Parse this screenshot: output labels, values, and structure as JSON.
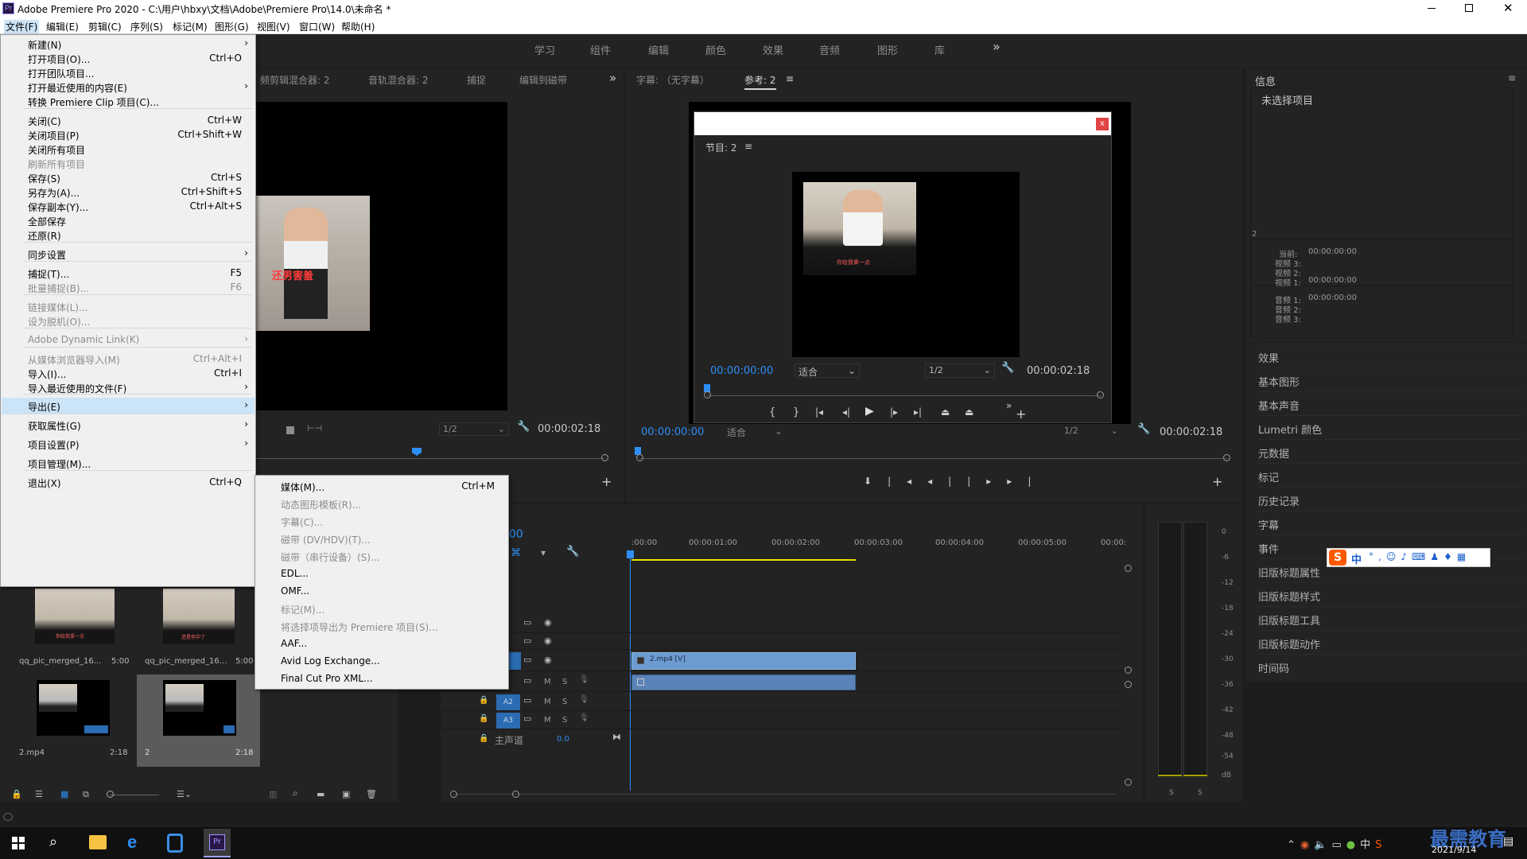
{
  "window": {
    "title": "Adobe Premiere Pro 2020 - C:\\用户\\hbxy\\文档\\Adobe\\Premiere Pro\\14.0\\未命名 *",
    "app_icon": "Pr",
    "controls": [
      "minimize-icon",
      "maximize-icon",
      "close-icon"
    ]
  },
  "menubar": [
    "文件(F)",
    "编辑(E)",
    "剪辑(C)",
    "序列(S)",
    "标记(M)",
    "图形(G)",
    "视图(V)",
    "窗口(W)",
    "帮助(H)"
  ],
  "workspaces": [
    "学习",
    "组件",
    "编辑",
    "颜色",
    "效果",
    "音频",
    "图形",
    "库"
  ],
  "workspace_more": "»",
  "source_panel": {
    "tabs": [
      "频剪辑混合器: 2",
      "音轨混合器: 2",
      "捕捉",
      "编辑到磁带"
    ],
    "more": "»",
    "res": "1/2",
    "timecode": "00:00:02:18",
    "caption": "还男害羞"
  },
  "program_panel": {
    "tabs": [
      "字幕: （无字幕）",
      "参考: 2"
    ],
    "dialog_close": "x",
    "dialog_label": "节目: 2",
    "video_caption": "你给我拿一点",
    "tc_left": "00:00:00:00",
    "fit": "适合",
    "res": "1/2",
    "tc_right": "00:00:02:18",
    "bottom_tc_left": "00:00:00:00",
    "bottom_fit": "适合",
    "bottom_res": "1/2",
    "bottom_tc_right": "00:00:02:18"
  },
  "info_panel": {
    "title": "信息",
    "none_selected": "未选择项目",
    "seq_num": "2",
    "current_label": "当前:",
    "current_tc": "00:00:00:00",
    "video3": "视频 3:",
    "video2": "视频 2:",
    "video1": "视频 1:",
    "video1_tc": "00:00:00:00",
    "audio1": "音频 1:",
    "audio1_tc": "00:00:00:00",
    "audio2": "音频 2:",
    "audio3": "音频 3:"
  },
  "right_panels": [
    "效果",
    "基本图形",
    "基本声音",
    "Lumetri 颜色",
    "元数据",
    "标记",
    "历史记录",
    "字幕",
    "事件",
    "旧版标题属性",
    "旧版标题样式",
    "旧版标题工具",
    "旧版标题动作",
    "时间码"
  ],
  "file_menu": {
    "items": [
      {
        "label": "新建(N)",
        "shortcut": "",
        "arrow": true,
        "disabled": false
      },
      {
        "label": "打开项目(O)...",
        "shortcut": "Ctrl+O",
        "arrow": false,
        "disabled": false
      },
      {
        "label": "打开团队项目...",
        "shortcut": "",
        "arrow": false,
        "disabled": false
      },
      {
        "label": "打开最近使用的内容(E)",
        "shortcut": "",
        "arrow": true,
        "disabled": false
      },
      {
        "label": "转换 Premiere Clip 项目(C)...",
        "shortcut": "",
        "arrow": false,
        "disabled": false
      },
      {
        "label": "关闭(C)",
        "shortcut": "Ctrl+W",
        "arrow": false,
        "disabled": false
      },
      {
        "label": "关闭项目(P)",
        "shortcut": "Ctrl+Shift+W",
        "arrow": false,
        "disabled": false
      },
      {
        "label": "关闭所有项目",
        "shortcut": "",
        "arrow": false,
        "disabled": false
      },
      {
        "label": "刷新所有项目",
        "shortcut": "",
        "arrow": false,
        "disabled": true
      },
      {
        "label": "保存(S)",
        "shortcut": "Ctrl+S",
        "arrow": false,
        "disabled": false
      },
      {
        "label": "另存为(A)...",
        "shortcut": "Ctrl+Shift+S",
        "arrow": false,
        "disabled": false
      },
      {
        "label": "保存副本(Y)...",
        "shortcut": "Ctrl+Alt+S",
        "arrow": false,
        "disabled": false
      },
      {
        "label": "全部保存",
        "shortcut": "",
        "arrow": false,
        "disabled": false
      },
      {
        "label": "还原(R)",
        "shortcut": "",
        "arrow": false,
        "disabled": false
      },
      {
        "label": "同步设置",
        "shortcut": "",
        "arrow": true,
        "disabled": false
      },
      {
        "label": "捕捉(T)...",
        "shortcut": "F5",
        "arrow": false,
        "disabled": false
      },
      {
        "label": "批量捕捉(B)...",
        "shortcut": "F6",
        "arrow": false,
        "disabled": true
      },
      {
        "label": "链接媒体(L)...",
        "shortcut": "",
        "arrow": false,
        "disabled": true
      },
      {
        "label": "设为脱机(O)...",
        "shortcut": "",
        "arrow": false,
        "disabled": true
      },
      {
        "label": "Adobe Dynamic Link(K)",
        "shortcut": "",
        "arrow": true,
        "disabled": true
      },
      {
        "label": "从媒体浏览器导入(M)",
        "shortcut": "Ctrl+Alt+I",
        "arrow": false,
        "disabled": true
      },
      {
        "label": "导入(I)...",
        "shortcut": "Ctrl+I",
        "arrow": false,
        "disabled": false
      },
      {
        "label": "导入最近使用的文件(F)",
        "shortcut": "",
        "arrow": true,
        "disabled": false
      },
      {
        "label": "导出(E)",
        "shortcut": "",
        "arrow": true,
        "disabled": false
      },
      {
        "label": "获取属性(G)",
        "shortcut": "",
        "arrow": true,
        "disabled": false
      },
      {
        "label": "项目设置(P)",
        "shortcut": "",
        "arrow": true,
        "disabled": false
      },
      {
        "label": "项目管理(M)...",
        "shortcut": "",
        "arrow": false,
        "disabled": false
      },
      {
        "label": "退出(X)",
        "shortcut": "Ctrl+Q",
        "arrow": false,
        "disabled": false
      }
    ]
  },
  "export_menu": {
    "items": [
      {
        "label": "媒体(M)...",
        "shortcut": "Ctrl+M",
        "disabled": false
      },
      {
        "label": "动态图形模板(R)...",
        "shortcut": "",
        "disabled": true
      },
      {
        "label": "字幕(C)...",
        "shortcut": "",
        "disabled": true
      },
      {
        "label": "磁带 (DV/HDV)(T)...",
        "shortcut": "",
        "disabled": true
      },
      {
        "label": "磁带（串行设备）(S)...",
        "shortcut": "",
        "disabled": true
      },
      {
        "label": "EDL...",
        "shortcut": "",
        "disabled": false
      },
      {
        "label": "OMF...",
        "shortcut": "",
        "disabled": false
      },
      {
        "label": "标记(M)...",
        "shortcut": "",
        "disabled": true
      },
      {
        "label": "将选择项导出为 Premiere 项目(S)...",
        "shortcut": "",
        "disabled": true
      },
      {
        "label": "AAF...",
        "shortcut": "",
        "disabled": false
      },
      {
        "label": "Avid Log Exchange...",
        "shortcut": "",
        "disabled": false
      },
      {
        "label": "Final Cut Pro XML...",
        "shortcut": "",
        "disabled": false
      }
    ]
  },
  "project_bin": {
    "items": [
      {
        "name": "qq_pic_merged_16...",
        "dur": "5:00",
        "caption": "你给我拿一点"
      },
      {
        "name": "qq_pic_merged_16...",
        "dur": "5:00",
        "caption": "还是你中了"
      },
      {
        "name": "2.mp4",
        "dur": "2:18"
      },
      {
        "name": "2",
        "dur": "2:18"
      }
    ]
  },
  "timeline": {
    "tc_fragment": "00",
    "ruler": [
      ":00:00",
      "00:00:01:00",
      "00:00:02:00",
      "00:00:03:00",
      "00:00:04:00",
      "00:00:05:00",
      "00:00:"
    ],
    "clip_label": "2.mp4 [V]",
    "tracks": {
      "a2": "A2",
      "a3": "A3",
      "m": "M",
      "s": "S",
      "master": "主声道",
      "master_val": "0.0"
    }
  },
  "meter": {
    "labels": [
      "0",
      "-6",
      "-12",
      "-18",
      "-24",
      "-30",
      "-36",
      "-42",
      "-48",
      "-54",
      "dB"
    ],
    "solo": [
      "S",
      "S"
    ]
  },
  "ime_bar": {
    "lang": "中"
  },
  "taskbar": {
    "time_label": "最需教育",
    "date": "2021/9/14"
  },
  "colors": {
    "accent_blue": "#2e8ef5",
    "menu_highlight": "#cce4f7",
    "clip_blue": "#6b9bd1",
    "premiere_purple": "#2a1647",
    "bg_dark": "#1d1d1d",
    "panel": "#232323"
  }
}
